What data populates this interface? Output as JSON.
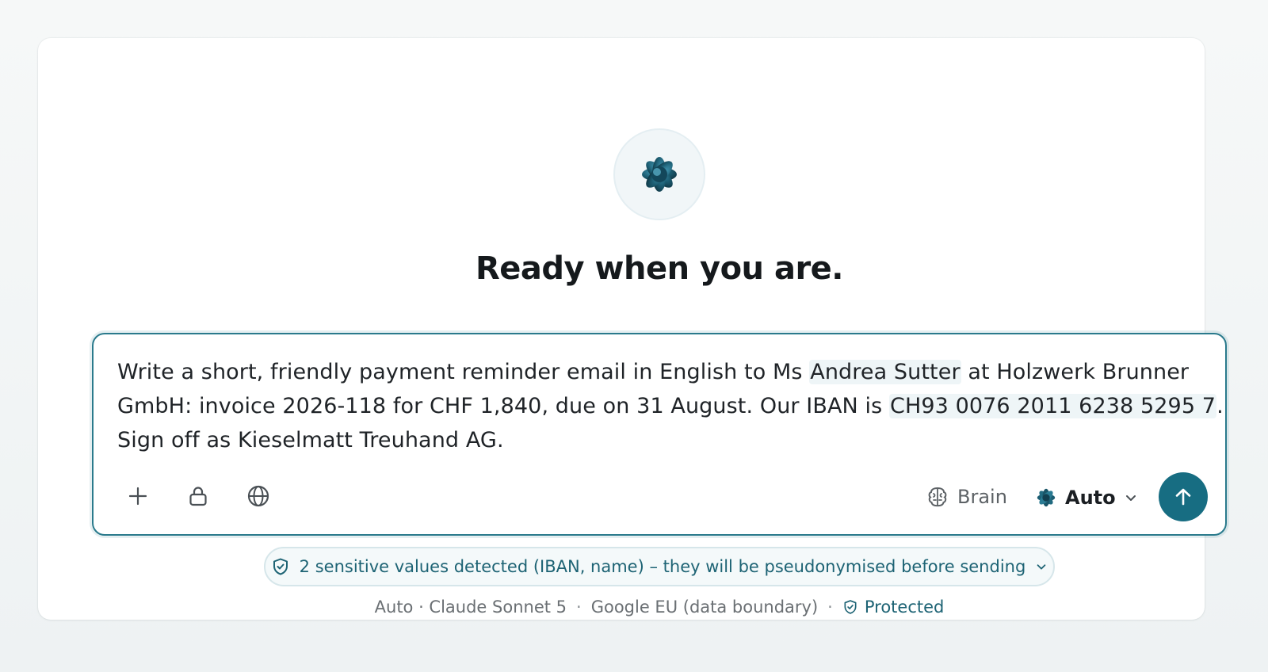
{
  "hero": {
    "title": "Ready when you are."
  },
  "composer": {
    "prompt_parts": {
      "p1": "Write a short, friendly payment reminder email in English to Ms ",
      "name": "Andrea Sutter",
      "p2": " at Holzwerk Brunner",
      "p3": "GmbH: invoice 2026-118 for CHF 1,840, due on 31 August. Our IBAN is ",
      "iban": "CH93 0076 2011 6238 5295 7",
      "p4": ".",
      "p5": "Sign off as Kieselmatt Treuhand AG."
    },
    "tools": [
      "plus-icon",
      "lock-icon",
      "globe-icon"
    ],
    "brain_label": "Brain",
    "model_label": "Auto",
    "send_icon": "arrow-up-icon"
  },
  "notice": {
    "text": "2 sensitive values detected (IBAN, name) – they will be pseudonymised before sending"
  },
  "footer": {
    "model": "Auto · Claude Sonnet 5",
    "sep1": "·",
    "region": "Google EU (data boundary)",
    "sep2": "·",
    "protected": "Protected"
  },
  "colors": {
    "accent": "#176d82",
    "accent_text": "#1d6374",
    "highlight": "#eef5f7"
  }
}
